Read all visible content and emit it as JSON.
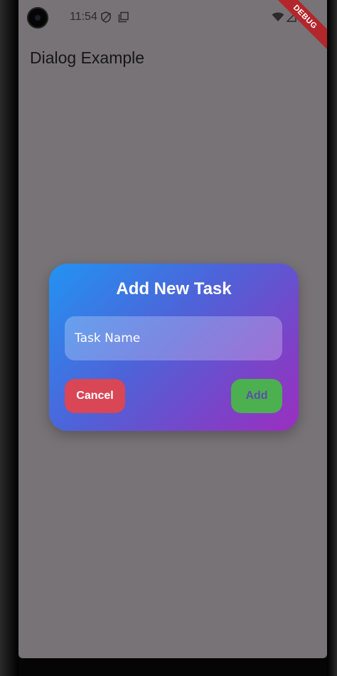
{
  "status_bar": {
    "time": "11:54",
    "debug_banner": "DEBUG"
  },
  "app_bar": {
    "title": "Dialog Example"
  },
  "dialog": {
    "title": "Add New Task",
    "input_placeholder": "Task Name",
    "cancel_label": "Cancel",
    "add_label": "Add"
  },
  "colors": {
    "cancel_button": "#d94656",
    "add_button": "#4caf50",
    "gradient_start": "#2293f2",
    "gradient_end": "#9a2fc0",
    "scrim": "#787376"
  }
}
